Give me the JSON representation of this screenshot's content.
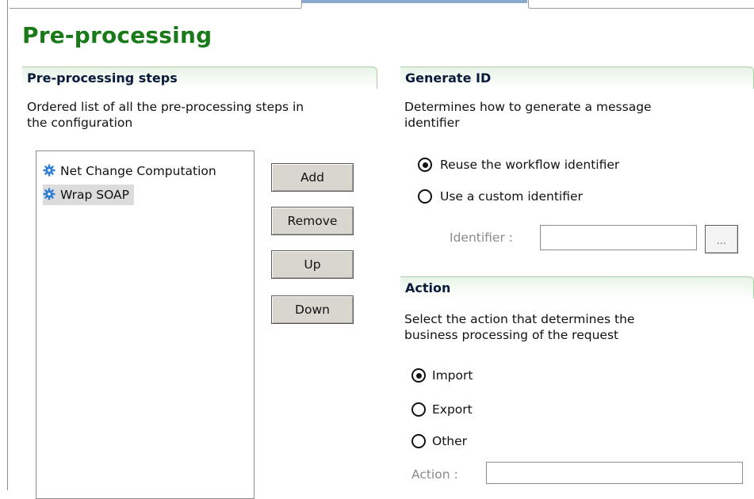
{
  "page": {
    "title": "Pre-processing"
  },
  "steps_section": {
    "title": "Pre-processing steps",
    "description_line1": "Ordered list of all the pre-processing steps in",
    "description_line2": "the configuration",
    "items": [
      {
        "label": "Net Change Computation",
        "icon": "gear-icon",
        "selected": false
      },
      {
        "label": "Wrap SOAP",
        "icon": "gear-icon",
        "selected": true
      }
    ],
    "buttons": {
      "add": "Add",
      "remove": "Remove",
      "up": "Up",
      "down": "Down"
    }
  },
  "generate_id": {
    "title": "Generate ID",
    "description_line1": "Determines how to generate a message",
    "description_line2": "identifier",
    "options": [
      {
        "label": "Reuse the workflow identifier",
        "checked": true
      },
      {
        "label": "Use a custom identifier",
        "checked": false
      }
    ],
    "identifier_label": "Identifier :",
    "identifier_value": "",
    "browse_label": "..."
  },
  "action": {
    "title": "Action",
    "description_line1": "Select the action that determines the",
    "description_line2": "business processing of the request",
    "options": [
      {
        "label": "Import",
        "checked": true
      },
      {
        "label": "Export",
        "checked": false
      },
      {
        "label": "Other",
        "checked": false
      }
    ],
    "action_label": "Action :",
    "action_value": ""
  },
  "colors": {
    "title_green": "#1a7a1a",
    "header_border": "#a9cfa9",
    "button_face": "#d9d6cf",
    "selection": "#dcdcdc",
    "gear_blue": "#2f7fd6"
  }
}
